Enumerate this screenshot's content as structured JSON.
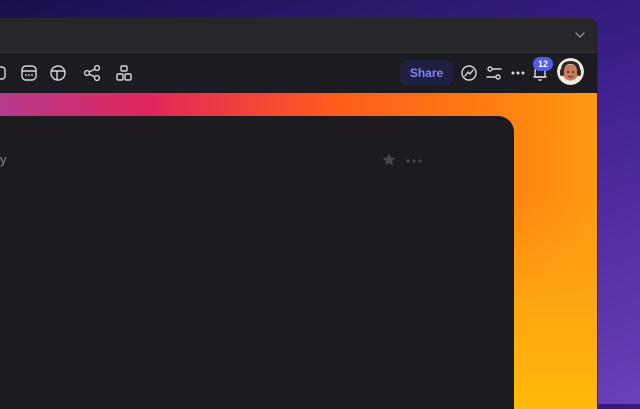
{
  "toolbar": {
    "share_label": "Share",
    "notifications_count": "12"
  },
  "card": {
    "title_fragment": "y"
  },
  "colors": {
    "accent": "#7b82ff",
    "badge": "#4e5cf0",
    "toolbar_bg": "#1c1b21",
    "card_bg": "#1d1b1f"
  },
  "icons": [
    "frame-icon",
    "calendar-icon",
    "layout-icon",
    "share-nodes-icon",
    "components-icon",
    "chart-icon",
    "settings-sliders-icon",
    "more-icon",
    "bell-icon",
    "star-icon",
    "chevron-down-icon"
  ]
}
